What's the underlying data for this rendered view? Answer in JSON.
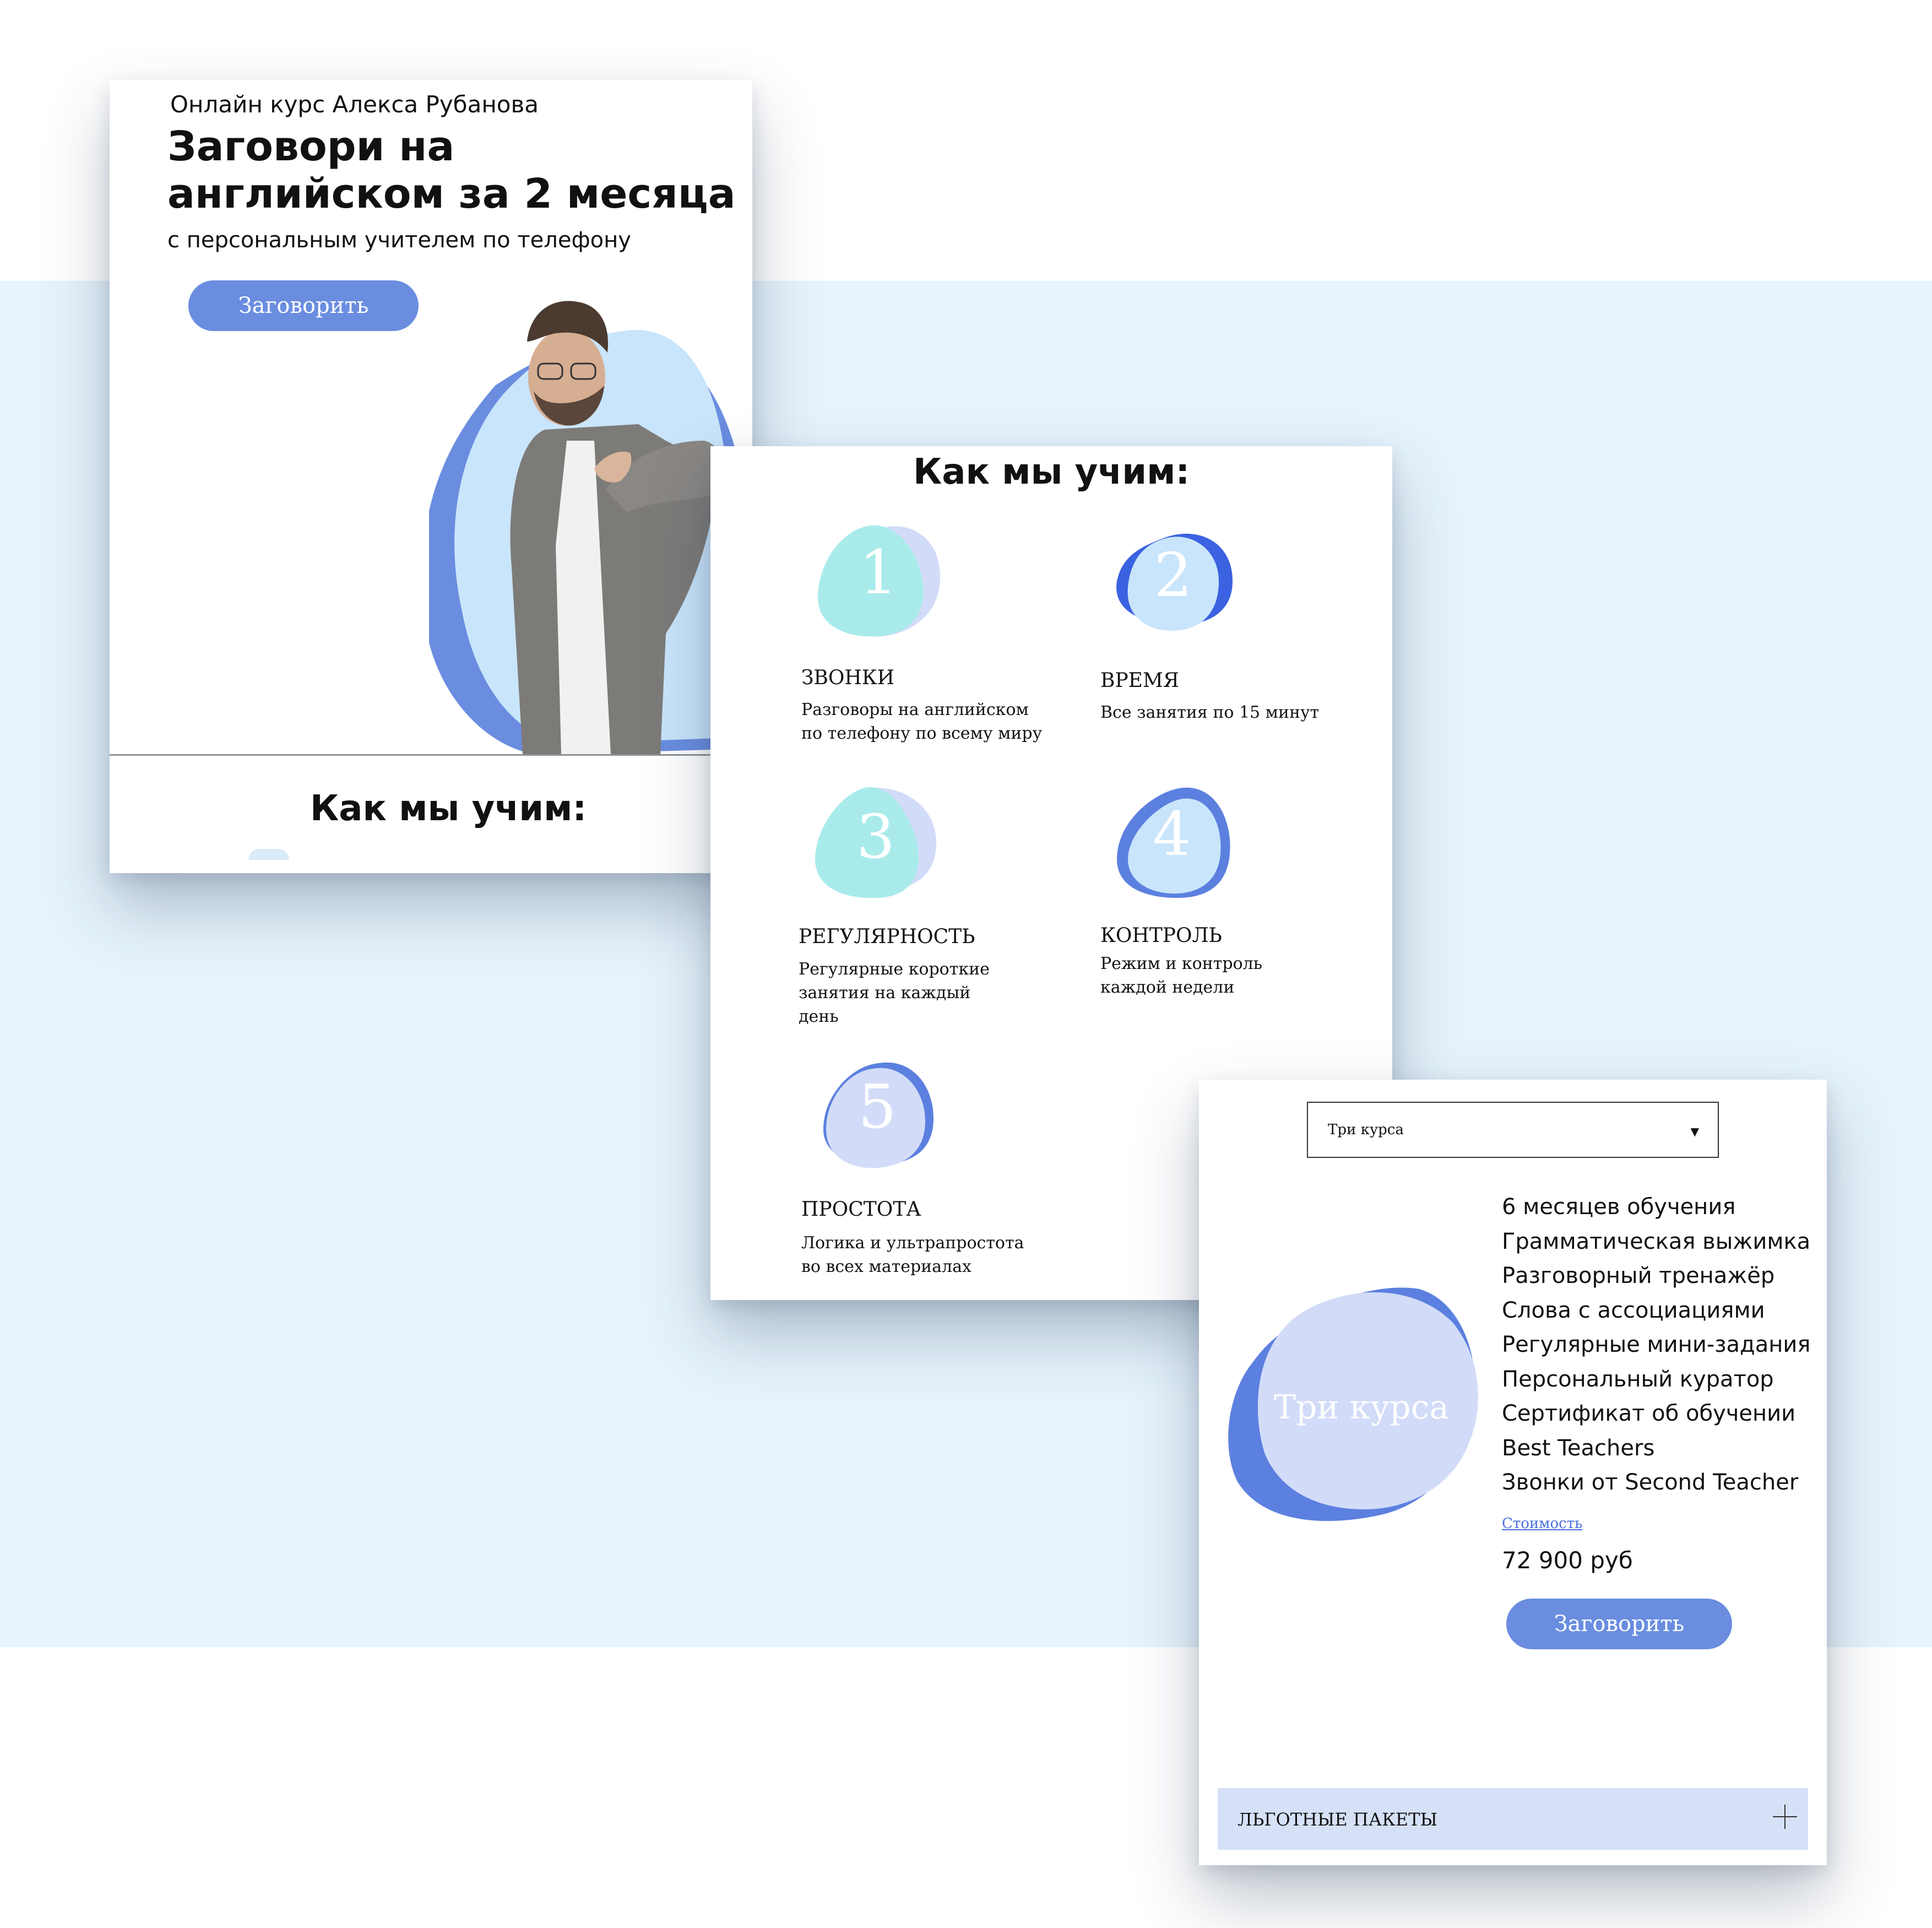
{
  "colors": {
    "band": "#e6f3fc",
    "accent": "#6a8de0",
    "mint": "#a9ebeb",
    "lightblue": "#c9e5fb",
    "deepblue": "#3b62e0",
    "lavender": "#d2dcf8"
  },
  "hero": {
    "course_by": "Онлайн курс Алекса Рубанова",
    "headline": "Заговори на английском за 2 месяца",
    "subheadline": "с персональным учителем по телефону",
    "cta_label": "Заговорить",
    "section_title": "Как мы учим:"
  },
  "how_we_teach": {
    "title": "Как мы учим:",
    "steps": [
      {
        "num": "1",
        "title": "ЗВОНКИ",
        "desc": "Разговоры на английском\nпо телефону по всему миру",
        "icon": "teal-blob-icon"
      },
      {
        "num": "2",
        "title": "ВРЕМЯ",
        "desc": "Все занятия по 15 минут",
        "icon": "blue-blob-icon"
      },
      {
        "num": "3",
        "title": "РЕГУЛЯРНОСТЬ",
        "desc": "Регулярные короткие\nзанятия на каждый\nдень",
        "icon": "teal-blob-icon"
      },
      {
        "num": "4",
        "title": "КОНТРОЛЬ",
        "desc": "Режим и контроль\nкаждой недели",
        "icon": "blue-blob-icon"
      },
      {
        "num": "5",
        "title": "ПРОСТОТА",
        "desc": "Логика и ультрапростота\nво всех материалах",
        "icon": "lavender-blob-icon"
      }
    ]
  },
  "pricing": {
    "select_value": "Три курса",
    "blob_label": "Три курса",
    "features": [
      "6 месяцев обучения",
      "Грамматическая выжимка",
      "Разговорный тренажёр",
      "Слова с ассоциациями",
      "Регулярные мини-задания",
      "Персональный куратор",
      "Сертификат об обучении",
      "Best Teachers",
      "Звонки от Second Teacher"
    ],
    "price_label": "Стоимость",
    "price": "72 900 руб",
    "cta_label": "Заговорить",
    "accordion_label": "ЛЬГОТНЫЕ ПАКЕТЫ"
  }
}
